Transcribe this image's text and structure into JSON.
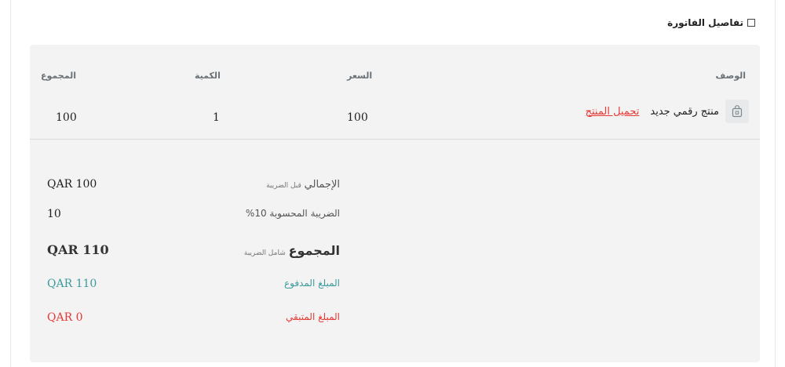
{
  "section": {
    "title": "تفاصيل الفاتورة"
  },
  "table": {
    "headers": {
      "description": "الوصف",
      "price": "السعر",
      "quantity": "الكمية",
      "total": "المجموع"
    },
    "rows": [
      {
        "name": "منتج رقمي جديد",
        "download_label": "تحميل المنتج",
        "price": "100",
        "quantity": "1",
        "total": "100"
      }
    ]
  },
  "summary": {
    "subtotal": {
      "label": "الإجمالي",
      "sub": "قبل الضريبة",
      "value": "QAR 100"
    },
    "tax": {
      "label": "الضريبة المحسوبة 10%",
      "value": "10"
    },
    "total": {
      "label": "المجموع",
      "sub": "شامل الضريبة",
      "value": "QAR 110"
    },
    "paid": {
      "label": "المبلغ المدفوع",
      "value": "QAR 110"
    },
    "remaining": {
      "label": "المبلغ المتبقي",
      "value": "QAR 0"
    }
  },
  "colors": {
    "paid": "#3c9a9c",
    "remaining": "#e53935",
    "link": "#e53935"
  }
}
